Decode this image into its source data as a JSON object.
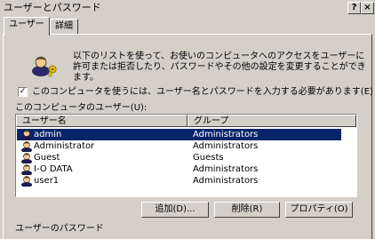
{
  "window": {
    "title": "ユーザーとパスワード",
    "help_label": "?",
    "close_label": "×"
  },
  "tabs": [
    {
      "label": "ユーザー"
    },
    {
      "label": "詳細"
    }
  ],
  "intro": {
    "text": "以下のリストを使って、お使いのコンピュータへのアクセスをユーザーに許可または拒否したり、パスワードやその他の設定を変更することができます。"
  },
  "require_login": {
    "checked": true,
    "check_glyph": "✓",
    "label": "このコンピュータを使うには、ユーザー名とパスワードを入力する必要があります(E)"
  },
  "users_section": {
    "label": "このコンピュータのユーザー(U):",
    "columns": {
      "name": "ユーザー名",
      "group": "グループ"
    },
    "rows": [
      {
        "name": "admin",
        "group": "Administrators",
        "selected": true
      },
      {
        "name": "Administrator",
        "group": "Administrators",
        "selected": false
      },
      {
        "name": "Guest",
        "group": "Guests",
        "selected": false
      },
      {
        "name": "I-O DATA",
        "group": "Administrators",
        "selected": false
      },
      {
        "name": "user1",
        "group": "Administrators",
        "selected": false
      }
    ]
  },
  "buttons": {
    "add": "追加(D)...",
    "remove": "削除(R)",
    "properties": "プロパティ(O)"
  },
  "password_section": {
    "label": "ユーザーのパスワード"
  },
  "colors": {
    "dialog_bg": "#d4d0c8",
    "selection": "#0a246a",
    "list_bg": "#ffffff"
  },
  "icons": {
    "users": "users-keys-icon",
    "user": "user-icon"
  }
}
